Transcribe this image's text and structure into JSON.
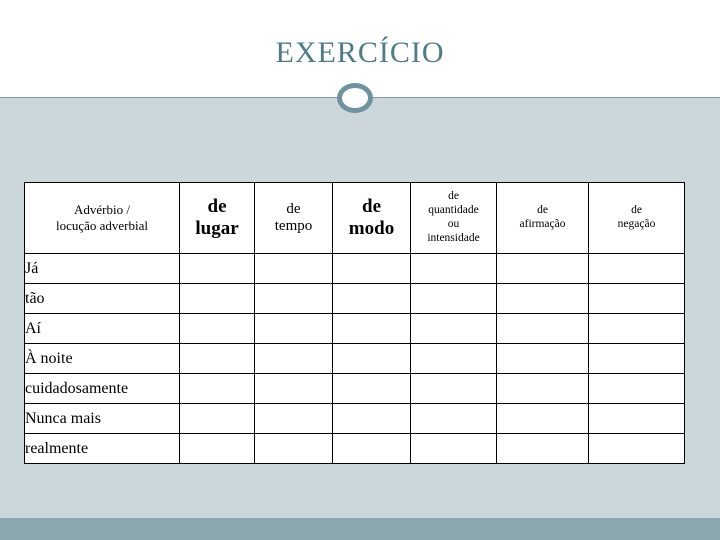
{
  "slide": {
    "title": "EXERCÍCIO",
    "accent_color": "#4f7a88",
    "background_color": "#ccd7db",
    "band_color": "#8aa7ad"
  },
  "table": {
    "headers": [
      "Advérbio / locução  adverbial",
      "de lugar",
      "de tempo",
      "de modo",
      "de quantidade ou intensidade",
      "de afirmação",
      "de negação"
    ],
    "header_parts": {
      "col0_line1": "Advérbio /",
      "col0_line2": "locução  adverbial",
      "col1_line1": "de",
      "col1_line2": "lugar",
      "col2_line1": "de",
      "col2_line2": "tempo",
      "col3_line1": "de",
      "col3_line2": "modo",
      "col4_line1": "de",
      "col4_line2": "quantidade",
      "col4_line3": "ou",
      "col4_line4": "intensidade",
      "col5_line1": "de",
      "col5_line2": "afirmação",
      "col6_line1": "de",
      "col6_line2": "negação"
    },
    "rows": [
      {
        "label": "Já"
      },
      {
        "label": "tão"
      },
      {
        "label": "Aí"
      },
      {
        "label": "À noite"
      },
      {
        "label": "cuidadosamente"
      },
      {
        "label": "Nunca mais"
      },
      {
        "label": "realmente"
      }
    ]
  }
}
